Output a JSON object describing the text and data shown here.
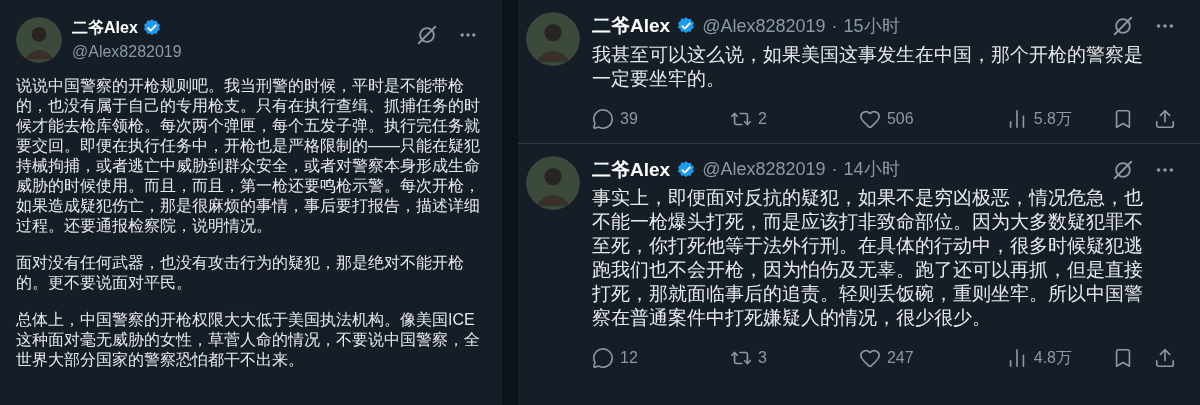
{
  "left_post": {
    "author": {
      "name": "二爷Alex",
      "handle": "@Alex8282019"
    },
    "paragraphs": [
      "说说中国警察的开枪规则吧。我当刑警的时候，平时是不能带枪的，也没有属于自己的专用枪支。只有在执行查缉、抓捕任务的时候才能去枪库领枪。每次两个弹匣，每个五发子弹。执行完任务就要交回。即便在执行任务中，开枪也是严格限制的——只能在疑犯持械拘捕，或者逃亡中威胁到群众安全，或者对警察本身形成生命威胁的时候使用。而且，而且，第一枪还要鸣枪示警。每次开枪，如果造成疑犯伤亡，那是很麻烦的事情，事后要打报告，描述详细过程。还要通报检察院，说明情况。",
      "面对没有任何武器，也没有攻击行为的疑犯，那是绝对不能开枪的。更不要说面对平民。",
      "总体上，中国警察的开枪权限大大低于美国执法机构。像美国ICE这种面对毫无威胁的女性，草菅人命的情况，不要说中国警察，全世界大部分国家的警察恐怕都干不出来。"
    ]
  },
  "thread": [
    {
      "author": {
        "name": "二爷Alex",
        "handle": "@Alex8282019"
      },
      "separator": "·",
      "time": "15小时",
      "text": "我甚至可以这么说，如果美国这事发生在中国，那个开枪的警察是一定要坐牢的。",
      "stats": {
        "replies": "39",
        "reposts": "2",
        "likes": "506",
        "views": "5.8万"
      }
    },
    {
      "author": {
        "name": "二爷Alex",
        "handle": "@Alex8282019"
      },
      "separator": "·",
      "time": "14小时",
      "text": "事实上，即便面对反抗的疑犯，如果不是穷凶极恶，情况危急，也不能一枪爆头打死，而是应该打非致命部位。因为大多数疑犯罪不至死，你打死他等于法外行刑。在具体的行动中，很多时候疑犯逃跑我们也不会开枪，因为怕伤及无辜。跑了还可以再抓，但是直接打死，那就面临事后的追责。轻则丢饭碗，重则坐牢。所以中国警察在普通案件中打死嫌疑人的情况，很少很少。",
      "stats": {
        "replies": "12",
        "reposts": "3",
        "likes": "247",
        "views": "4.8万"
      }
    }
  ]
}
